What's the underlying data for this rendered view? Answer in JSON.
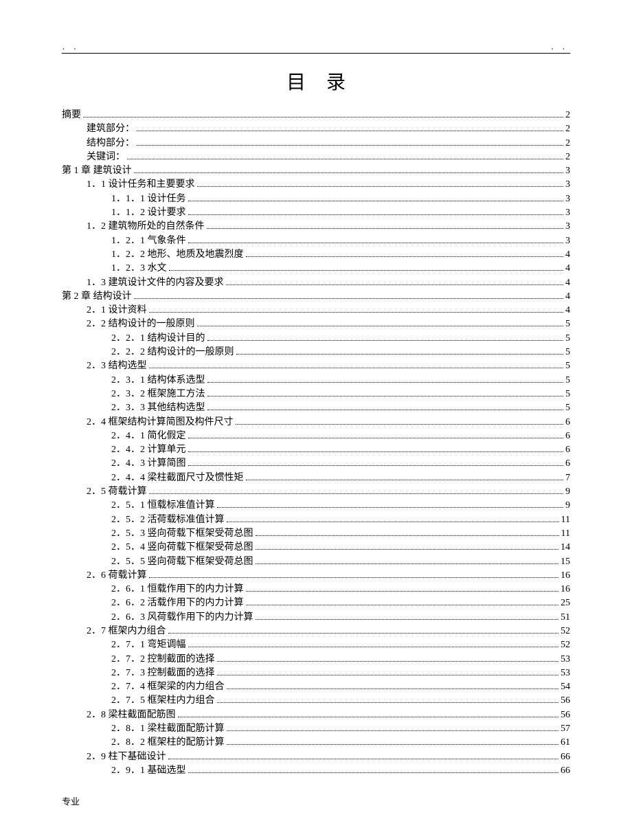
{
  "header": {
    "left": "．        ．",
    "right": "．            ．"
  },
  "title": "目录",
  "toc": [
    {
      "label": "摘要",
      "page": "2",
      "indent": 0
    },
    {
      "label": "建筑部分：",
      "page": "2",
      "indent": 1
    },
    {
      "label": "结构部分：",
      "page": "2",
      "indent": 1
    },
    {
      "label": "关键词：",
      "page": "2",
      "indent": 1
    },
    {
      "label": "第 1 章   建筑设计",
      "page": "3",
      "indent": 0
    },
    {
      "label": "1．1  设计任务和主要要求",
      "page": "3",
      "indent": 1
    },
    {
      "label": "1．1．1  设计任务",
      "page": "3",
      "indent": 2
    },
    {
      "label": "1．1．2  设计要求",
      "page": "3",
      "indent": 2
    },
    {
      "label": "1．2  建筑物所处的自然条件",
      "page": "3",
      "indent": 1
    },
    {
      "label": "1．2．1  气象条件",
      "page": "3",
      "indent": 2
    },
    {
      "label": "1．2．2  地形、地质及地震烈度",
      "page": "4",
      "indent": 2
    },
    {
      "label": "1．2．3  水文",
      "page": "4",
      "indent": 2
    },
    {
      "label": "1．3  建筑设计文件的内容及要求",
      "page": "4",
      "indent": 1
    },
    {
      "label": "第 2 章   结构设计",
      "page": "4",
      "indent": 0
    },
    {
      "label": "2．1  设计资料",
      "page": "4",
      "indent": 1
    },
    {
      "label": "2．2  结构设计的一般原则",
      "page": "5",
      "indent": 1
    },
    {
      "label": "2．2．1  结构设计目的",
      "page": "5",
      "indent": 2
    },
    {
      "label": "2．2．2  结构设计的一般原则",
      "page": "5",
      "indent": 2
    },
    {
      "label": "2．3  结构选型",
      "page": "5",
      "indent": 1
    },
    {
      "label": "2．3．1  结构体系选型",
      "page": "5",
      "indent": 2
    },
    {
      "label": "2．3．2  框架施工方法",
      "page": "5",
      "indent": 2
    },
    {
      "label": "2．3．3  其他结构选型",
      "page": "5",
      "indent": 2
    },
    {
      "label": "2．4  框架结构计算简图及构件尺寸",
      "page": "6",
      "indent": 1
    },
    {
      "label": "2．4．1  简化假定",
      "page": "6",
      "indent": 2
    },
    {
      "label": "2．4．2  计算单元",
      "page": "6",
      "indent": 2
    },
    {
      "label": "2．4．3  计算简图",
      "page": "6",
      "indent": 2
    },
    {
      "label": "2．4．4  梁柱截面尺寸及惯性矩",
      "page": "7",
      "indent": 2
    },
    {
      "label": "2．5  荷载计算",
      "page": "9",
      "indent": 1
    },
    {
      "label": "2．5．1  恒载标准值计算",
      "page": "9",
      "indent": 2
    },
    {
      "label": "2．5．2  活荷载标准值计算",
      "page": "11",
      "indent": 2
    },
    {
      "label": "2．5．3  竖向荷载下框架受荷总图",
      "page": "11",
      "indent": 2
    },
    {
      "label": "2．5．4  竖向荷载下框架受荷总图",
      "page": "14",
      "indent": 2
    },
    {
      "label": "2．5．5  竖向荷载下框架受荷总图",
      "page": "15",
      "indent": 2
    },
    {
      "label": "2．6  荷载计算",
      "page": "16",
      "indent": 1
    },
    {
      "label": "2．6．1  恒载作用下的内力计算",
      "page": "16",
      "indent": 2
    },
    {
      "label": "2．6．2  活载作用下的内力计算",
      "page": "25",
      "indent": 2
    },
    {
      "label": "2．6．3  风荷载作用下的内力计算",
      "page": "51",
      "indent": 2
    },
    {
      "label": "2．7  框架内力组合",
      "page": "52",
      "indent": 1
    },
    {
      "label": "2．7．1  弯矩调幅",
      "page": "52",
      "indent": 2
    },
    {
      "label": "2．7．2  控制截面的选择",
      "page": "53",
      "indent": 2
    },
    {
      "label": "2．7．3  控制截面的选择",
      "page": "53",
      "indent": 2
    },
    {
      "label": "2．7．4  框架梁的内力组合",
      "page": "54",
      "indent": 2
    },
    {
      "label": "2．7．5   框架柱内力组合",
      "page": "56",
      "indent": 2
    },
    {
      "label": "2．8  梁柱截面配筋图",
      "page": "56",
      "indent": 1
    },
    {
      "label": "2．8．1   梁柱截面配筋计算",
      "page": "57",
      "indent": 2
    },
    {
      "label": "2．8．2   框架柱的配筋计算",
      "page": "61",
      "indent": 2
    },
    {
      "label": "2．9  柱下基础设计",
      "page": "66",
      "indent": 1
    },
    {
      "label": "2．9．1   基础选型",
      "page": "66",
      "indent": 2
    }
  ],
  "footer": "专业"
}
